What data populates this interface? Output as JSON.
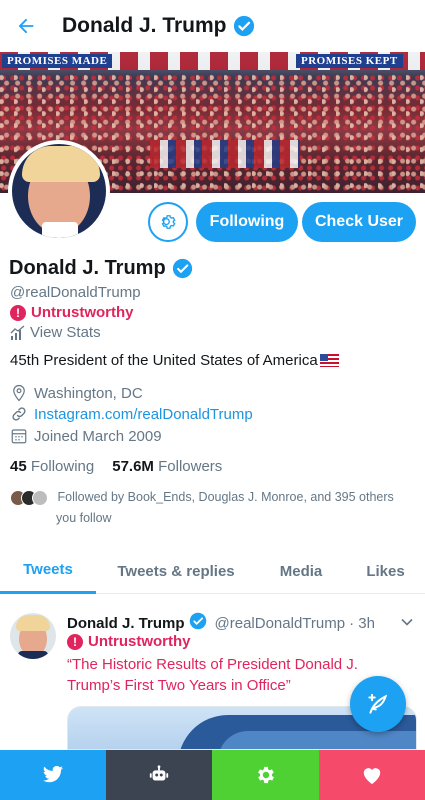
{
  "header": {
    "title": "Donald J. Trump"
  },
  "banner": {
    "sign_left": "PROMISES MADE",
    "sign_right": "PROMISES KEPT"
  },
  "actions": {
    "following_label": "Following",
    "check_user_label": "Check User"
  },
  "profile": {
    "name": "Donald J. Trump",
    "handle": "@realDonaldTrump",
    "badge": "Untrustworthy",
    "stats_link": "View Stats",
    "bio": "45th President of the United States of America",
    "location": "Washington, DC",
    "website": "Instagram.com/realDonaldTrump",
    "joined": "Joined March 2009",
    "following_count": "45",
    "following_label": "Following",
    "followers_count": "57.6M",
    "followers_label": "Followers",
    "followed_by_line1": "Followed by Book_Ends, Douglas J. Monroe, and 395 others",
    "followed_by_line2": "you follow"
  },
  "tabs": [
    {
      "label": "Tweets",
      "active": true
    },
    {
      "label": "Tweets & replies",
      "active": false
    },
    {
      "label": "Media",
      "active": false
    },
    {
      "label": "Likes",
      "active": false
    }
  ],
  "tweet": {
    "name": "Donald J. Trump",
    "handle": "@realDonaldTrump",
    "time": "· 3h",
    "badge": "Untrustworthy",
    "text": "“The Historic Results of President Donald J. Trump’s First Two Years in Office”"
  },
  "icons": {
    "back": "arrow-left-icon",
    "verified": "verified-badge-icon",
    "settings": "gear-icon",
    "stats": "bar-chart-icon",
    "location": "location-pin-icon",
    "link": "link-icon",
    "calendar": "calendar-icon",
    "compose": "compose-tweet-icon",
    "bottom": [
      "twitter-bird-icon",
      "robot-icon",
      "gear-icon",
      "heart-icon"
    ]
  },
  "colors": {
    "accent": "#1da1f2",
    "alert": "#e0245e",
    "bottom_bar": [
      "#1da1f2",
      "#3d4451",
      "#4fd134",
      "#f64a6b"
    ]
  }
}
